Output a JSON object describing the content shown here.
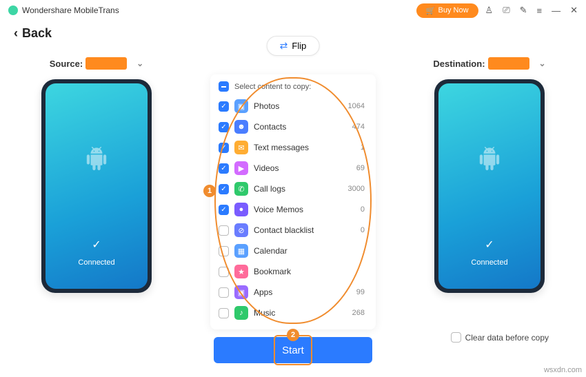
{
  "titlebar": {
    "app_name": "Wondershare MobileTrans",
    "buy_now": "Buy Now"
  },
  "nav": {
    "back": "Back",
    "flip": "Flip"
  },
  "source": {
    "label": "Source:",
    "connected": "Connected"
  },
  "destination": {
    "label": "Destination:",
    "connected": "Connected"
  },
  "content": {
    "header": "Select content to copy:",
    "items": [
      {
        "label": "Photos",
        "count": "1064",
        "checked": true,
        "icon": "ic-photos",
        "glyph": "▣"
      },
      {
        "label": "Contacts",
        "count": "474",
        "checked": true,
        "icon": "ic-contacts",
        "glyph": "☻"
      },
      {
        "label": "Text messages",
        "count": "1",
        "checked": true,
        "icon": "ic-text",
        "glyph": "✉"
      },
      {
        "label": "Videos",
        "count": "69",
        "checked": true,
        "icon": "ic-videos",
        "glyph": "▶"
      },
      {
        "label": "Call logs",
        "count": "3000",
        "checked": true,
        "icon": "ic-calllogs",
        "glyph": "✆"
      },
      {
        "label": "Voice Memos",
        "count": "0",
        "checked": true,
        "icon": "ic-voice",
        "glyph": "●"
      },
      {
        "label": "Contact blacklist",
        "count": "0",
        "checked": false,
        "icon": "ic-blacklist",
        "glyph": "⊘"
      },
      {
        "label": "Calendar",
        "count": "",
        "checked": false,
        "icon": "ic-calendar",
        "glyph": "▦"
      },
      {
        "label": "Bookmark",
        "count": "",
        "checked": false,
        "icon": "ic-bookmark",
        "glyph": "★"
      },
      {
        "label": "Apps",
        "count": "99",
        "checked": false,
        "icon": "ic-apps",
        "glyph": "▣"
      },
      {
        "label": "Music",
        "count": "268",
        "checked": false,
        "icon": "ic-music",
        "glyph": "♪"
      }
    ]
  },
  "actions": {
    "start": "Start",
    "clear": "Clear data before copy"
  },
  "annotations": {
    "badge1": "1",
    "badge2": "2"
  },
  "watermark": "wsxdn.com"
}
